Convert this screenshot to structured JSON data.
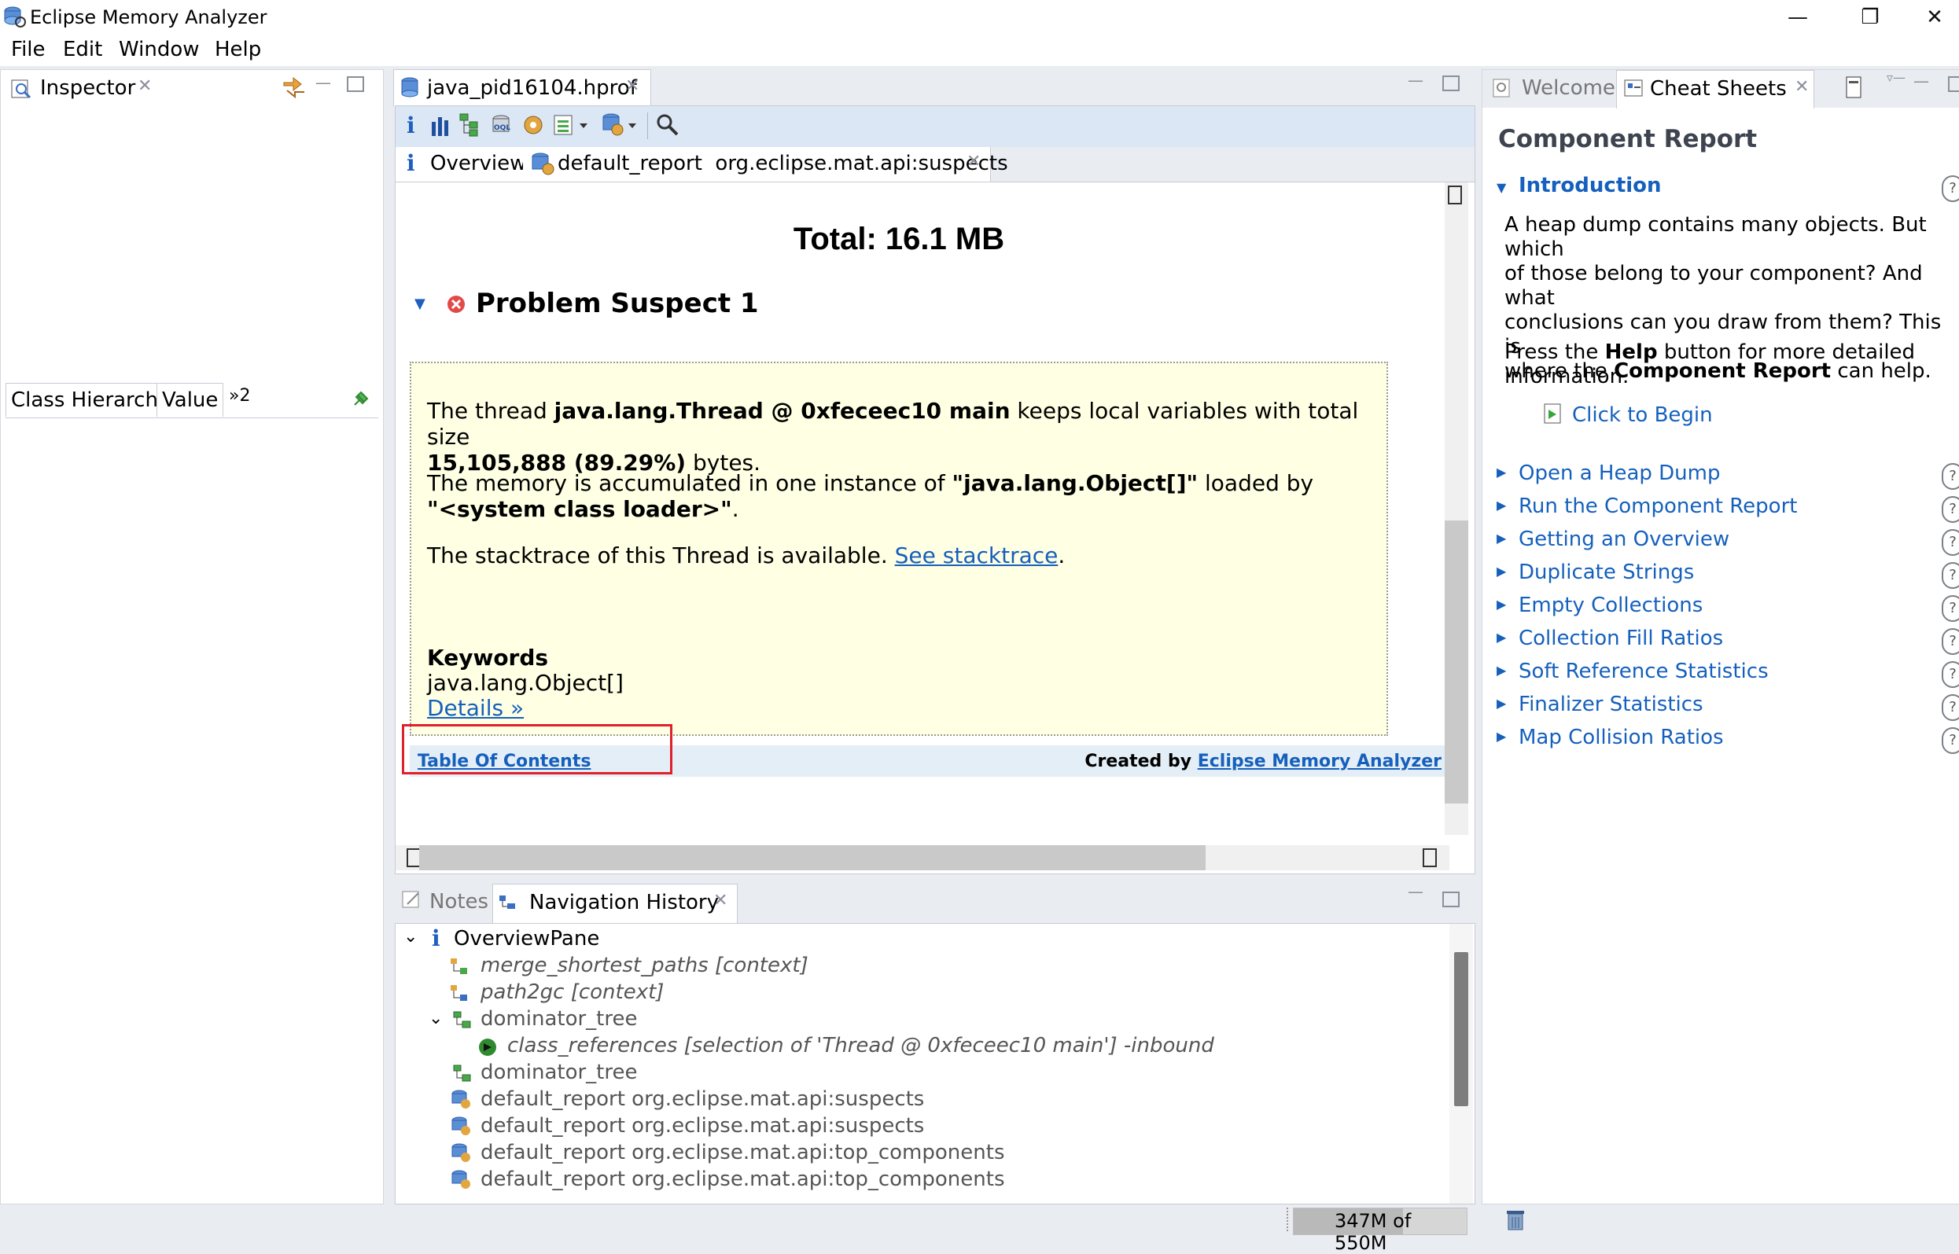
{
  "window": {
    "title": "Eclipse Memory Analyzer",
    "controls": [
      "—",
      "❐",
      "✕"
    ]
  },
  "menu": {
    "file": "File",
    "edit": "Edit",
    "window": "Window",
    "help": "Help"
  },
  "inspector": {
    "tab": "Inspector",
    "subtabs": [
      "Class Hierarchy",
      "Value"
    ],
    "overflow": "»2"
  },
  "editor": {
    "file_tab": "java_pid16104.hprof",
    "subtabs": {
      "overview": "Overview",
      "report": "default_report  org.eclipse.mat.api:suspects"
    },
    "report": {
      "total": "Total: 16.1 MB",
      "suspect_title": "Problem Suspect 1",
      "p1_a": "The thread ",
      "p1_b": "java.lang.Thread @ 0xfeceec10 main",
      "p1_c": " keeps local variables with total size",
      "p1_d": "15,105,888 (89.29%)",
      "p1_e": " bytes.",
      "p2_a": "The memory is accumulated in one instance of ",
      "p2_b": "\"java.lang.Object[]\"",
      "p2_c": " loaded by",
      "p2_d": "\"<system class loader>\"",
      "p2_e": ".",
      "p3_a": "The stacktrace of this Thread is available. ",
      "p3_link": "See stacktrace",
      "p3_end": ".",
      "keywords_label": "Keywords",
      "keyword": "java.lang.Object[]",
      "details_link": "Details »",
      "toc_link": "Table Of Contents",
      "created_by": "Created by ",
      "created_link": "Eclipse Memory Analyzer"
    }
  },
  "cheatsheet": {
    "tabs": {
      "welcome": "Welcome",
      "cheat": "Cheat Sheets"
    },
    "title": "Component Report",
    "intro": "Introduction",
    "intro_text_1": "A heap dump contains many objects. But which",
    "intro_text_2": "of those belong to your component? And what",
    "intro_text_3": "conclusions can you draw from them? This is",
    "intro_text_4a": "where the ",
    "intro_text_4b": "Component Report",
    "intro_text_4c": " can help.",
    "press_a": "Press the ",
    "press_b": "Help",
    "press_c": " button for more detailed",
    "press_d": "information.",
    "click_to_begin": "Click to Begin",
    "items": [
      "Open a Heap Dump",
      "Run the Component Report",
      "Getting an Overview",
      "Duplicate Strings",
      "Empty Collections",
      "Collection Fill Ratios",
      "Soft Reference Statistics",
      "Finalizer Statistics",
      "Map Collision Ratios"
    ]
  },
  "history": {
    "tabs": {
      "notes": "Notes",
      "nav": "Navigation History"
    },
    "rows": [
      "OverviewPane",
      "merge_shortest_paths  [context]",
      "path2gc  [context]",
      "dominator_tree",
      "class_references  [selection of 'Thread @ 0xfeceec10  main'] -inbound",
      "dominator_tree",
      "default_report  org.eclipse.mat.api:suspects",
      "default_report  org.eclipse.mat.api:suspects",
      "default_report  org.eclipse.mat.api:top_components",
      "default_report  org.eclipse.mat.api:top_components"
    ]
  },
  "status": {
    "heap": "347M of 550M"
  }
}
